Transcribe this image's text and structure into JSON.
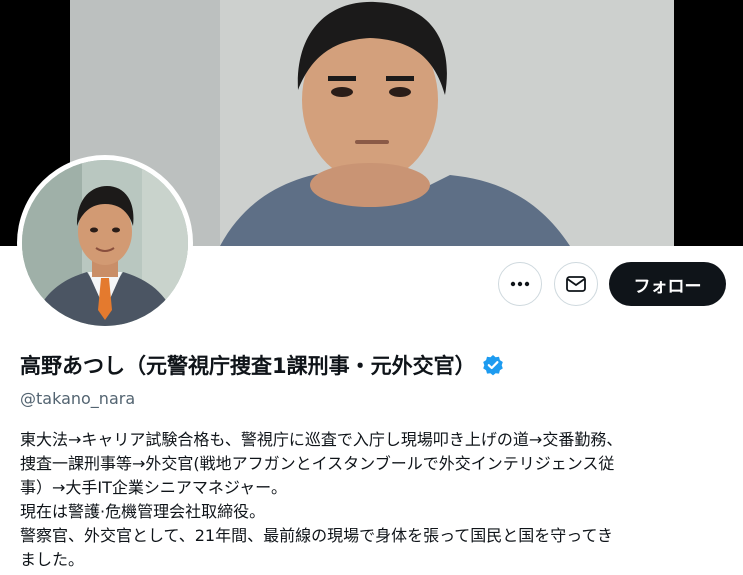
{
  "profile": {
    "name": "高野あつし（元警視庁捜査1課刑事・元外交官）",
    "handle": "@takano_nara",
    "verified": true,
    "bio_lines": [
      "東大法→キャリア試験合格も、警視庁に巡査で入庁し現場叩き上げの道→交番勤務、",
      "捜査一課刑事等→外交官(戦地アフガンとイスタンブールで外交インテリジェンス従",
      "事）→大手IT企業シニアマネジャー。",
      "現在は警護·危機管理会社取締役。",
      "警察官、外交官として、21年間、最前線の現場で身体を張って国民と国を守ってき",
      "ました。"
    ]
  },
  "actions": {
    "more_label": "•••",
    "follow_label": "フォロー"
  },
  "icons": {
    "more": "more-dots-icon",
    "message": "envelope-icon",
    "verified": "verified-badge-icon"
  },
  "colors": {
    "verified_blue": "#1d9bf0",
    "follow_bg": "#0f1419",
    "handle_gray": "#536471"
  }
}
